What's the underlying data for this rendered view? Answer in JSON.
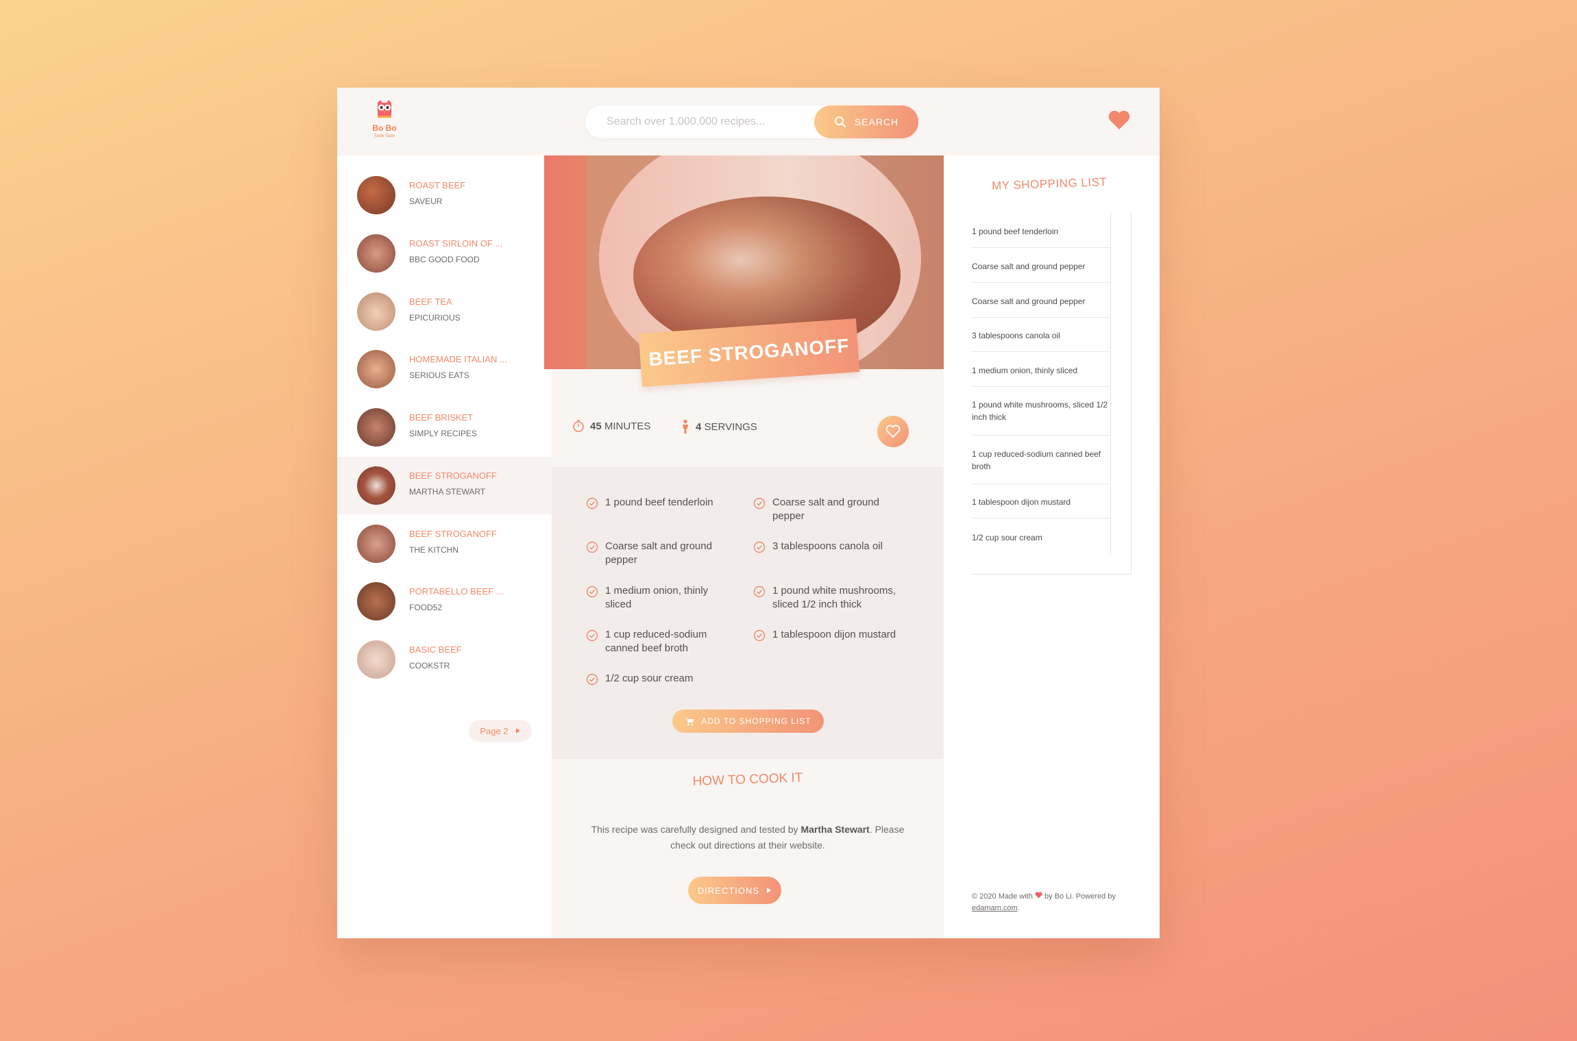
{
  "brand": {
    "name": "Bo Bo",
    "tagline": "Taste Taste"
  },
  "search": {
    "placeholder": "Search over 1,000,000 recipes...",
    "button_label": "SEARCH"
  },
  "sidebar": {
    "items": [
      {
        "title": "ROAST BEEF",
        "source": "SAVEUR"
      },
      {
        "title": "ROAST SIRLOIN OF ...",
        "source": "BBC GOOD FOOD"
      },
      {
        "title": "BEEF TEA",
        "source": "EPICURIOUS"
      },
      {
        "title": "HOMEMADE ITALIAN ...",
        "source": "SERIOUS EATS"
      },
      {
        "title": "BEEF BRISKET",
        "source": "SIMPLY RECIPES"
      },
      {
        "title": "BEEF STROGANOFF",
        "source": "MARTHA STEWART"
      },
      {
        "title": "BEEF STROGANOFF",
        "source": "THE KITCHN"
      },
      {
        "title": "PORTABELLO BEEF ...",
        "source": "FOOD52"
      },
      {
        "title": "BASIC BEEF",
        "source": "COOKSTR"
      }
    ],
    "page_label": "Page 2"
  },
  "recipe": {
    "title": "BEEF STROGANOFF",
    "time_value": "45",
    "time_unit": "MINUTES",
    "servings_value": "4",
    "servings_unit": "SERVINGS",
    "ingredients": [
      "1 pound beef tenderloin",
      "Coarse salt and ground pepper",
      "Coarse salt and ground pepper",
      "3 tablespoons canola oil",
      "1 medium onion, thinly sliced",
      "1 pound white mushrooms, sliced 1/2 inch thick",
      "1 cup reduced-sodium canned beef broth",
      "1 tablespoon dijon mustard",
      "1/2 cup sour cream"
    ],
    "add_button": "ADD TO SHOPPING LIST"
  },
  "howto": {
    "title": "HOW TO COOK IT",
    "text_before": "This recipe was carefully designed and tested by ",
    "author": "Martha Stewart",
    "text_after": ". Please check out directions at their website.",
    "button": "DIRECTIONS"
  },
  "shopping": {
    "title": "MY SHOPPING LIST",
    "items": [
      "1 pound beef tenderloin",
      "Coarse salt and ground pepper",
      "Coarse salt and ground pepper",
      "3 tablespoons canola oil",
      "1 medium onion, thinly sliced",
      "1 pound white mushrooms, sliced 1/2 inch thick",
      "1 cup reduced-sodium canned beef broth",
      "1 tablespoon dijon mustard",
      "1/2 cup sour cream"
    ]
  },
  "footer": {
    "text": "© 2020 Made with",
    "by": " by Bo Li. Powered by",
    "link": "edamam.com",
    "period": "."
  },
  "colors": {
    "accent": "#f08a6a",
    "gradient_start": "#fbc98a",
    "gradient_end": "#f29377"
  }
}
